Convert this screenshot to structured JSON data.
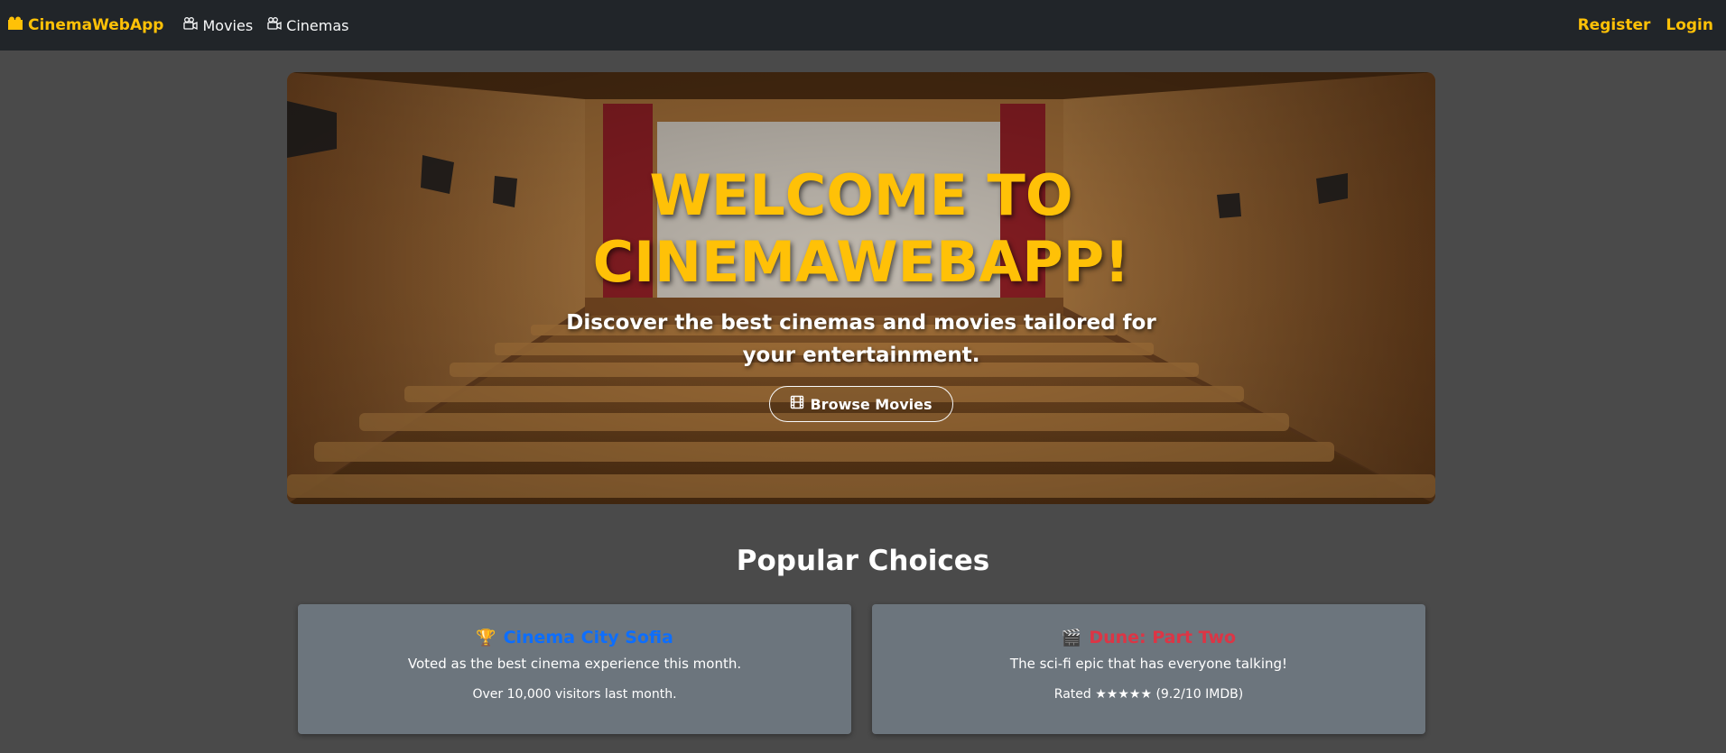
{
  "navbar": {
    "brand": "CinemaWebApp",
    "links": [
      {
        "label": "Movies"
      },
      {
        "label": "Cinemas"
      }
    ],
    "auth": {
      "register": "Register",
      "login": "Login"
    },
    "colors": {
      "background": "#212529",
      "accent": "#ffc107"
    }
  },
  "hero": {
    "title": "WELCOME TO CINEMAWEBAPP!",
    "subtitle": "Discover the best cinemas and movies tailored for your entertainment.",
    "button_label": "Browse Movies",
    "button_icon": "film-icon"
  },
  "popular": {
    "heading": "Popular Choices",
    "cards": [
      {
        "icon": "🏆",
        "title": "Cinema City Sofia",
        "title_color": "#0d6efd",
        "description": "Voted as the best cinema experience this month.",
        "meta": "Over 10,000 visitors last month."
      },
      {
        "icon": "🎬",
        "title": "Dune: Part Two",
        "title_color": "#dc3545",
        "description": "The sci-fi epic that has everyone talking!",
        "meta": "Rated ★★★★★ (9.2/10 IMDB)"
      }
    ]
  }
}
